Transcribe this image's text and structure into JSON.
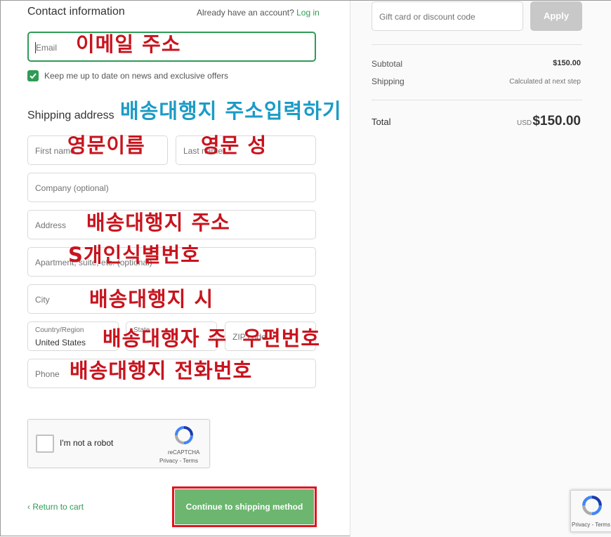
{
  "contact": {
    "title": "Contact information",
    "account_prompt": "Already have an account?",
    "login_link": "Log in",
    "email_placeholder": "Email",
    "newsletter_label": "Keep me up to date on news and exclusive offers"
  },
  "shipping": {
    "title": "Shipping address",
    "first_name_placeholder": "First name",
    "last_name_placeholder": "Last name",
    "company_placeholder": "Company (optional)",
    "address_placeholder": "Address",
    "apartment_placeholder": "Apartment, suite, etc. (optional)",
    "city_placeholder": "City",
    "country_label": "Country/Region",
    "country_value": "United States",
    "state_label": "State",
    "zip_placeholder": "ZIP code",
    "phone_placeholder": "Phone"
  },
  "captcha": {
    "label": "I'm not a robot",
    "brand": "reCAPTCHA",
    "links": "Privacy - Terms",
    "badge_links": "Privacy - Terms"
  },
  "footer": {
    "return_link": "Return to cart",
    "continue_button": "Continue to shipping method"
  },
  "summary": {
    "discount_placeholder": "Gift card or discount code",
    "apply_button": "Apply",
    "subtotal_label": "Subtotal",
    "subtotal_value": "$150.00",
    "shipping_label": "Shipping",
    "shipping_value": "Calculated at next step",
    "total_label": "Total",
    "currency": "USD",
    "total_value": "$150.00"
  },
  "annotations": {
    "email": "이메일 주소",
    "shipping_agent": "배송대행지 주소입력하기",
    "first_name": "영문이름",
    "last_name": "영문 성",
    "address": "배송대행지 주소",
    "personal_id": "S개인식별번호",
    "city": "배송대행지 시",
    "state_zip": "배송대행자 주  우편번호",
    "phone": "배송대행지 전화번호"
  },
  "colors": {
    "accent_green": "#2e9c55",
    "button_green": "#6cb670",
    "annotation_red": "#c8141e",
    "annotation_blue": "#1b9bc6",
    "highlight_border": "#e0141e"
  }
}
